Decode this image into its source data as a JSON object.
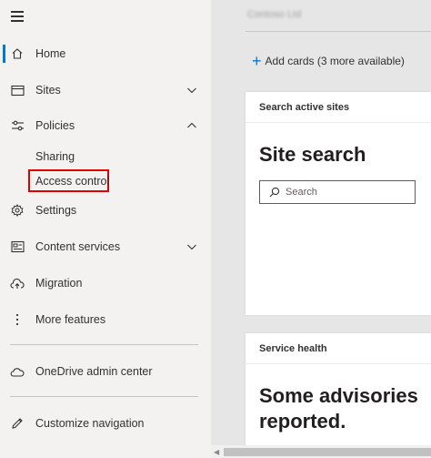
{
  "nav": {
    "items": [
      {
        "label": "Home",
        "icon": "home-icon"
      },
      {
        "label": "Sites",
        "icon": "sites-icon"
      },
      {
        "label": "Policies",
        "icon": "policies-icon"
      },
      {
        "label": "Settings",
        "icon": "gear-icon"
      },
      {
        "label": "Content services",
        "icon": "content-services-icon"
      },
      {
        "label": "Migration",
        "icon": "cloud-upload-icon"
      },
      {
        "label": "More features",
        "icon": "more-icon"
      },
      {
        "label": "OneDrive admin center",
        "icon": "onedrive-icon"
      },
      {
        "label": "Customize navigation",
        "icon": "pencil-icon"
      }
    ],
    "policies_sub": [
      {
        "label": "Sharing"
      },
      {
        "label": "Access control"
      }
    ],
    "active_item": "Home",
    "accent_color": "#0078d4",
    "highlight_color": "#e00000"
  },
  "main": {
    "tenant_name": "Contoso Ltd",
    "add_cards_label": "Add cards (3 more available)",
    "cards": [
      {
        "header": "Search active sites",
        "title": "Site search",
        "search_placeholder": "Search"
      },
      {
        "header": "Service health",
        "title_line1": "Some advisories",
        "title_line2": "reported."
      }
    ]
  }
}
